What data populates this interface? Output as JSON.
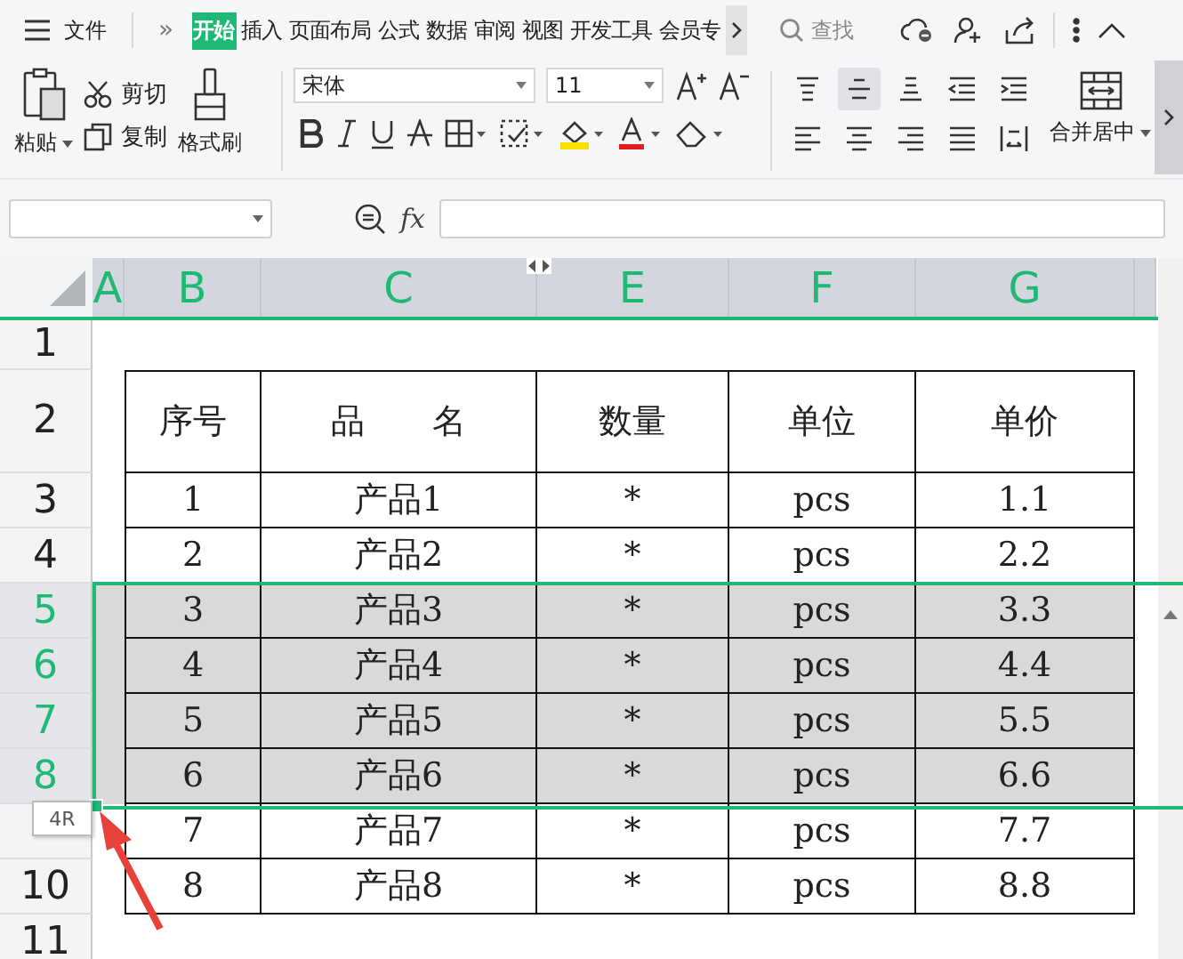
{
  "menu": {
    "file": "文件",
    "more_tabs": "»",
    "tabs": [
      {
        "label": "开始",
        "selected": true
      },
      {
        "label": "插入",
        "selected": false
      },
      {
        "label": "页面布局",
        "selected": false
      },
      {
        "label": "公式",
        "selected": false
      },
      {
        "label": "数据",
        "selected": false
      },
      {
        "label": "审阅",
        "selected": false
      },
      {
        "label": "视图",
        "selected": false
      },
      {
        "label": "开发工具",
        "selected": false
      },
      {
        "label": "会员专",
        "selected": false
      }
    ],
    "search": "查找"
  },
  "ribbon": {
    "paste": "粘贴",
    "cut": "剪切",
    "copy": "复制",
    "format_painter": "格式刷",
    "font": "宋体",
    "size": "11",
    "merge": "合并居中",
    "align_buttons": [
      {
        "selected": false
      },
      {
        "selected": true
      },
      {
        "selected": false
      },
      {
        "selected": false
      },
      {
        "selected": false
      },
      {
        "selected": false
      },
      {
        "selected": false
      },
      {
        "selected": false
      },
      {
        "selected": false
      },
      {
        "selected": false
      }
    ]
  },
  "formula_bar": {
    "fx": "fx"
  },
  "sheet": {
    "columns": [
      "A",
      "B",
      "C",
      "E",
      "F",
      "G"
    ],
    "rows": [
      {
        "number": "1",
        "kind": "blank",
        "selected": false
      },
      {
        "number": "2",
        "kind": "header",
        "selected": false,
        "cells": [
          "序号",
          "品　　名",
          "数量",
          "单位",
          "单价"
        ]
      },
      {
        "number": "3",
        "kind": "item",
        "selected": false,
        "cells": [
          "1",
          "产品1",
          "*",
          "pcs",
          "1.1"
        ]
      },
      {
        "number": "4",
        "kind": "item",
        "selected": false,
        "cells": [
          "2",
          "产品2",
          "*",
          "pcs",
          "2.2"
        ]
      },
      {
        "number": "5",
        "kind": "item",
        "selected": true,
        "cells": [
          "3",
          "产品3",
          "*",
          "pcs",
          "3.3"
        ]
      },
      {
        "number": "6",
        "kind": "item",
        "selected": true,
        "cells": [
          "4",
          "产品4",
          "*",
          "pcs",
          "4.4"
        ]
      },
      {
        "number": "7",
        "kind": "item",
        "selected": true,
        "cells": [
          "5",
          "产品5",
          "*",
          "pcs",
          "5.5"
        ]
      },
      {
        "number": "8",
        "kind": "item",
        "selected": true,
        "cells": [
          "6",
          "产品6",
          "*",
          "pcs",
          "6.6"
        ]
      },
      {
        "kind": "item",
        "selected": false,
        "cells": [
          "7",
          "产品7",
          "*",
          "pcs",
          "7.7"
        ]
      },
      {
        "number": "10",
        "kind": "item",
        "selected": false,
        "cells": [
          "8",
          "产品8",
          "*",
          "pcs",
          "8.8"
        ]
      },
      {
        "number": "11",
        "kind": "blank",
        "selected": false
      }
    ]
  },
  "tooltip": "4R"
}
